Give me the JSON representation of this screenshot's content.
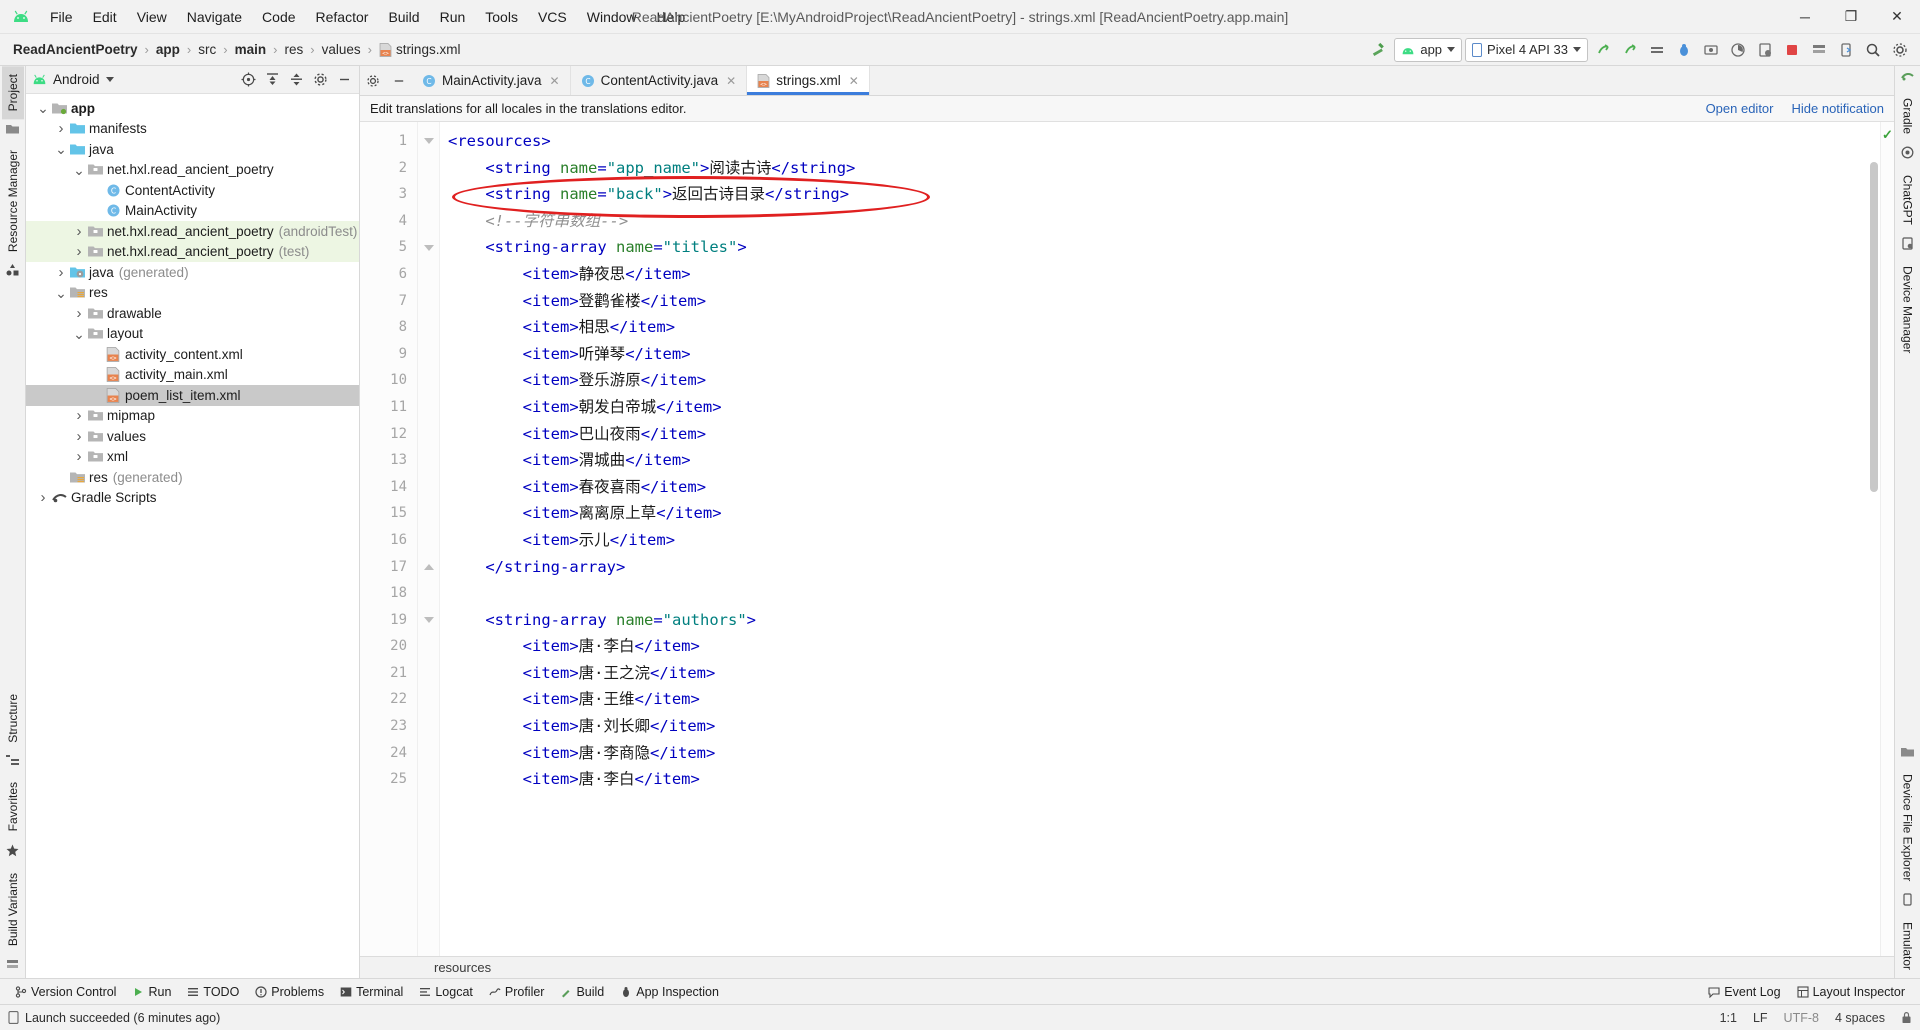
{
  "window": {
    "title": "ReadAncientPoetry [E:\\MyAndroidProject\\ReadAncientPoetry] - strings.xml [ReadAncientPoetry.app.main]",
    "minimize": "─",
    "maximize": "❐",
    "close": "✕"
  },
  "menu": {
    "items": [
      {
        "label": "File"
      },
      {
        "label": "Edit"
      },
      {
        "label": "View"
      },
      {
        "label": "Navigate"
      },
      {
        "label": "Code"
      },
      {
        "label": "Refactor"
      },
      {
        "label": "Build"
      },
      {
        "label": "Run"
      },
      {
        "label": "Tools"
      },
      {
        "label": "VCS"
      },
      {
        "label": "Window"
      },
      {
        "label": "Help"
      }
    ]
  },
  "breadcrumb": {
    "items": [
      "ReadAncientPoetry",
      "app",
      "src",
      "main",
      "res",
      "values"
    ],
    "file": "strings.xml",
    "separator": "›"
  },
  "toolbar": {
    "build_hammer": "build-icon",
    "run_config": "app",
    "device": "Pixel 4 API 33",
    "icons": [
      "run-icon",
      "debug-icon",
      "apply-changes-icon",
      "bug-icon",
      "attach-debugger-icon",
      "profiler-icon",
      "device-manager-icon",
      "stop-icon",
      "sdk-manager-icon",
      "avd-manager-icon",
      "search-icon",
      "settings-icon"
    ]
  },
  "left_strip": {
    "top": [
      "Project"
    ],
    "middle": [
      "Resource Manager"
    ],
    "bottom": [
      "Structure",
      "Favorites",
      "Build Variants"
    ]
  },
  "right_strip": {
    "top": [
      "Gradle",
      "ChatGPT",
      "Device Manager"
    ],
    "bottom": [
      "Device File Explorer",
      "Emulator"
    ]
  },
  "project_panel": {
    "title": "Android",
    "actions": [
      "target-icon",
      "expand-all-icon",
      "collapse-all-icon",
      "gear-icon",
      "hide-icon"
    ],
    "tree": [
      {
        "indent": 0,
        "arrow": "down",
        "icon": "module-folder",
        "label": "app",
        "bold": true,
        "suffix": "",
        "state": "normal"
      },
      {
        "indent": 1,
        "arrow": "right",
        "icon": "folder-blue",
        "label": "manifests",
        "bold": false,
        "suffix": "",
        "state": "normal"
      },
      {
        "indent": 1,
        "arrow": "down",
        "icon": "folder-blue",
        "label": "java",
        "bold": false,
        "suffix": "",
        "state": "normal"
      },
      {
        "indent": 2,
        "arrow": "down",
        "icon": "package",
        "label": "net.hxl.read_ancient_poetry",
        "bold": false,
        "suffix": "",
        "state": "normal"
      },
      {
        "indent": 3,
        "arrow": "none",
        "icon": "class",
        "label": "ContentActivity",
        "bold": false,
        "suffix": "",
        "state": "normal"
      },
      {
        "indent": 3,
        "arrow": "none",
        "icon": "class",
        "label": "MainActivity",
        "bold": false,
        "suffix": "",
        "state": "normal"
      },
      {
        "indent": 2,
        "arrow": "right",
        "icon": "package",
        "label": "net.hxl.read_ancient_poetry",
        "bold": false,
        "suffix": "(androidTest)",
        "state": "green"
      },
      {
        "indent": 2,
        "arrow": "right",
        "icon": "package",
        "label": "net.hxl.read_ancient_poetry",
        "bold": false,
        "suffix": "(test)",
        "state": "green"
      },
      {
        "indent": 1,
        "arrow": "right",
        "icon": "folder-gen",
        "label": "java",
        "bold": false,
        "suffix": "(generated)",
        "state": "normal"
      },
      {
        "indent": 1,
        "arrow": "down",
        "icon": "folder-res",
        "label": "res",
        "bold": false,
        "suffix": "",
        "state": "normal"
      },
      {
        "indent": 2,
        "arrow": "right",
        "icon": "package",
        "label": "drawable",
        "bold": false,
        "suffix": "",
        "state": "normal"
      },
      {
        "indent": 2,
        "arrow": "down",
        "icon": "package",
        "label": "layout",
        "bold": false,
        "suffix": "",
        "state": "normal"
      },
      {
        "indent": 3,
        "arrow": "none",
        "icon": "xml-file",
        "label": "activity_content.xml",
        "bold": false,
        "suffix": "",
        "state": "normal"
      },
      {
        "indent": 3,
        "arrow": "none",
        "icon": "xml-file",
        "label": "activity_main.xml",
        "bold": false,
        "suffix": "",
        "state": "normal"
      },
      {
        "indent": 3,
        "arrow": "none",
        "icon": "xml-file",
        "label": "poem_list_item.xml",
        "bold": false,
        "suffix": "",
        "state": "selected"
      },
      {
        "indent": 2,
        "arrow": "right",
        "icon": "package",
        "label": "mipmap",
        "bold": false,
        "suffix": "",
        "state": "normal"
      },
      {
        "indent": 2,
        "arrow": "right",
        "icon": "package",
        "label": "values",
        "bold": false,
        "suffix": "",
        "state": "normal"
      },
      {
        "indent": 2,
        "arrow": "right",
        "icon": "package",
        "label": "xml",
        "bold": false,
        "suffix": "",
        "state": "normal"
      },
      {
        "indent": 1,
        "arrow": "none",
        "icon": "folder-res",
        "label": "res",
        "bold": false,
        "suffix": "(generated)",
        "state": "normal"
      },
      {
        "indent": 0,
        "arrow": "right",
        "icon": "gradle",
        "label": "Gradle Scripts",
        "bold": false,
        "suffix": "",
        "state": "normal"
      }
    ]
  },
  "editor_tabs": [
    {
      "label": "MainActivity.java",
      "icon": "java-class-icon",
      "active": false,
      "close": "✕"
    },
    {
      "label": "ContentActivity.java",
      "icon": "java-class-icon",
      "active": false,
      "close": "✕"
    },
    {
      "label": "strings.xml",
      "icon": "xml-file-icon",
      "active": true,
      "close": "✕"
    }
  ],
  "notification": {
    "message": "Edit translations for all locales in the translations editor.",
    "open_editor": "Open editor",
    "hide": "Hide notification"
  },
  "code": {
    "lines": [
      {
        "n": 1,
        "fold": "minus",
        "highlight": true,
        "indent": 0,
        "content": "<resources>",
        "type": "tag"
      },
      {
        "n": 2,
        "fold": "",
        "highlight": false,
        "indent": 1,
        "content": "<string name=\"app_name\">阅读古诗</string>",
        "type": "string"
      },
      {
        "n": 3,
        "fold": "",
        "highlight": false,
        "indent": 1,
        "content": "<string name=\"back\">返回古诗目录</string>",
        "type": "string"
      },
      {
        "n": 4,
        "fold": "",
        "highlight": false,
        "indent": 1,
        "content": "<!--字符串数组-->",
        "type": "comment"
      },
      {
        "n": 5,
        "fold": "minus",
        "highlight": false,
        "indent": 1,
        "content": "<string-array name=\"titles\">",
        "type": "arrayopen"
      },
      {
        "n": 6,
        "fold": "",
        "highlight": false,
        "indent": 2,
        "content": "<item>静夜思</item>",
        "type": "item"
      },
      {
        "n": 7,
        "fold": "",
        "highlight": false,
        "indent": 2,
        "content": "<item>登鹳雀楼</item>",
        "type": "item"
      },
      {
        "n": 8,
        "fold": "",
        "highlight": false,
        "indent": 2,
        "content": "<item>相思</item>",
        "type": "item"
      },
      {
        "n": 9,
        "fold": "",
        "highlight": false,
        "indent": 2,
        "content": "<item>听弹琴</item>",
        "type": "item"
      },
      {
        "n": 10,
        "fold": "",
        "highlight": false,
        "indent": 2,
        "content": "<item>登乐游原</item>",
        "type": "item"
      },
      {
        "n": 11,
        "fold": "",
        "highlight": false,
        "indent": 2,
        "content": "<item>朝发白帝城</item>",
        "type": "item"
      },
      {
        "n": 12,
        "fold": "",
        "highlight": false,
        "indent": 2,
        "content": "<item>巴山夜雨</item>",
        "type": "item"
      },
      {
        "n": 13,
        "fold": "",
        "highlight": false,
        "indent": 2,
        "content": "<item>渭城曲</item>",
        "type": "item"
      },
      {
        "n": 14,
        "fold": "",
        "highlight": false,
        "indent": 2,
        "content": "<item>春夜喜雨</item>",
        "type": "item"
      },
      {
        "n": 15,
        "fold": "",
        "highlight": false,
        "indent": 2,
        "content": "<item>离离原上草</item>",
        "type": "item"
      },
      {
        "n": 16,
        "fold": "",
        "highlight": false,
        "indent": 2,
        "content": "<item>示儿</item>",
        "type": "item"
      },
      {
        "n": 17,
        "fold": "plus",
        "highlight": false,
        "indent": 1,
        "content": "</string-array>",
        "type": "arrayclose"
      },
      {
        "n": 18,
        "fold": "",
        "highlight": false,
        "indent": 0,
        "content": "",
        "type": "blank"
      },
      {
        "n": 19,
        "fold": "minus",
        "highlight": false,
        "indent": 1,
        "content": "<string-array name=\"authors\">",
        "type": "arrayopen"
      },
      {
        "n": 20,
        "fold": "",
        "highlight": false,
        "indent": 2,
        "content": "<item>唐·李白</item>",
        "type": "item"
      },
      {
        "n": 21,
        "fold": "",
        "highlight": false,
        "indent": 2,
        "content": "<item>唐·王之浣</item>",
        "type": "item"
      },
      {
        "n": 22,
        "fold": "",
        "highlight": false,
        "indent": 2,
        "content": "<item>唐·王维</item>",
        "type": "item"
      },
      {
        "n": 23,
        "fold": "",
        "highlight": false,
        "indent": 2,
        "content": "<item>唐·刘长卿</item>",
        "type": "item"
      },
      {
        "n": 24,
        "fold": "",
        "highlight": false,
        "indent": 2,
        "content": "<item>唐·李商隐</item>",
        "type": "item"
      },
      {
        "n": 25,
        "fold": "",
        "highlight": false,
        "indent": 2,
        "content": "<item>唐·李白</item>",
        "type": "item"
      }
    ],
    "inspection_status": "✓"
  },
  "editor_status": {
    "element": "resources"
  },
  "tool_windows": {
    "left": [
      {
        "label": "Version Control",
        "icon": "branch-icon"
      },
      {
        "label": "Run",
        "icon": "run-icon"
      },
      {
        "label": "TODO",
        "icon": "todo-icon"
      },
      {
        "label": "Problems",
        "icon": "problems-icon"
      },
      {
        "label": "Terminal",
        "icon": "terminal-icon"
      },
      {
        "label": "Logcat",
        "icon": "logcat-icon"
      },
      {
        "label": "Profiler",
        "icon": "profiler-icon"
      },
      {
        "label": "Build",
        "icon": "build-icon"
      },
      {
        "label": "App Inspection",
        "icon": "app-inspection-icon"
      }
    ],
    "right": [
      {
        "label": "Event Log",
        "icon": "event-log-icon"
      },
      {
        "label": "Layout Inspector",
        "icon": "layout-inspector-icon"
      }
    ]
  },
  "status_bar": {
    "message": "Launch succeeded (6 minutes ago)",
    "caret": "1:1",
    "line_sep": "LF",
    "encoding": "UTF-8",
    "indent": "4 spaces",
    "lock": "lock-icon"
  }
}
